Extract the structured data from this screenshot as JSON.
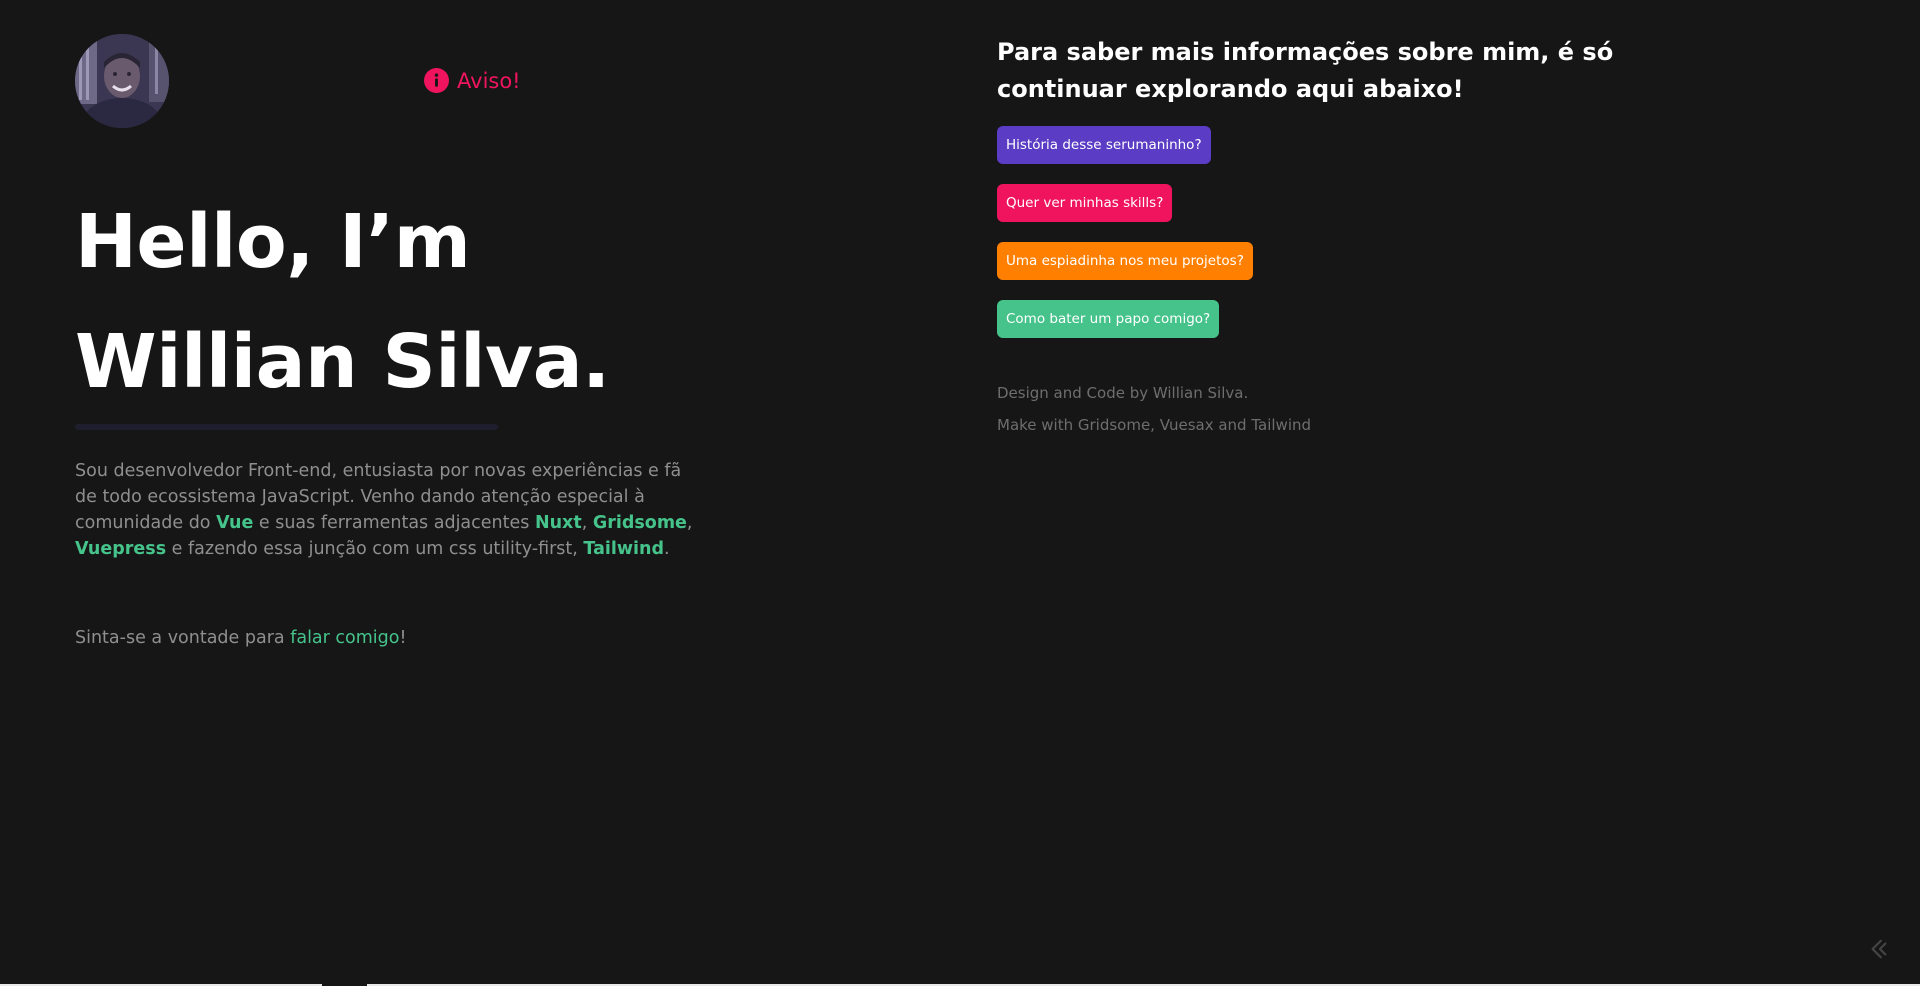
{
  "header": {
    "notice_label": "Aviso!"
  },
  "hero": {
    "line1": "Hello, I’m",
    "line2": "Willian Silva."
  },
  "bio": {
    "part1": "Sou desenvolvedor Front-end, entusiasta por novas experiências e fã de todo ecossistema JavaScript. Venho dando atenção especial à comunidade do ",
    "vue": "Vue",
    "part2": " e suas ferramentas adjacentes ",
    "nuxt": "Nuxt",
    "sep1": ", ",
    "gridsome": "Gridsome",
    "sep2": ", ",
    "vuepress": "Vuepress",
    "part3": " e fazendo essa junção com um css utility-first, ",
    "tailwind": "Tailwind",
    "end": "."
  },
  "cta": {
    "prefix": "Sinta-se a vontade para ",
    "link": "falar comigo",
    "suffix": "!"
  },
  "right": {
    "heading": "Para saber mais informações sobre mim, é só continuar explorando aqui abaixo!",
    "buttons": [
      {
        "label": "História desse serumaninho?",
        "color": "#5b3cc4"
      },
      {
        "label": "Quer ver minhas skills?",
        "color": "#f0145f"
      },
      {
        "label": "Uma espiadinha nos meu projetos?",
        "color": "#ff8000"
      },
      {
        "label": "Como bater um papo comigo?",
        "color": "#45c38a"
      }
    ],
    "credits": {
      "line1": "Design and Code by Willian Silva.",
      "line2": "Make with Gridsome, Vuesax and Tailwind"
    }
  },
  "colors": {
    "background": "#161617",
    "accent_green": "#45c38a",
    "accent_pink": "#f0145f",
    "accent_purple": "#5b3cc4",
    "accent_orange": "#ff8000"
  },
  "icons": {
    "notice": "info-icon",
    "corner": "gridsome-icon"
  }
}
